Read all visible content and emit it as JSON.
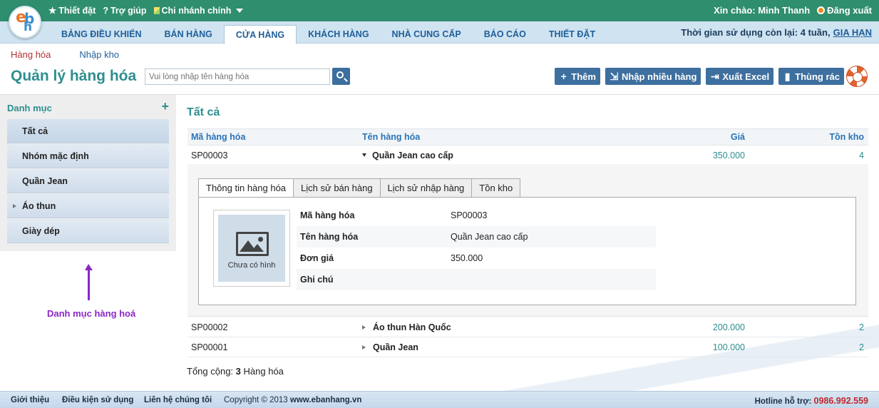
{
  "app": {
    "logo_letters": [
      "e",
      "b",
      "h"
    ],
    "greeting": "Xin chào: Minh Thanh",
    "logout": "Đăng xuất",
    "top_links": [
      {
        "label": "Thiết đặt",
        "icon": "star-icon"
      },
      {
        "label": "Trợ giúp",
        "icon": "help-icon"
      },
      {
        "label": "Chi nhánh chính",
        "icon": "pencil-icon"
      }
    ]
  },
  "nav": {
    "tabs": [
      "BẢNG ĐIỀU KHIỂN",
      "BÁN HÀNG",
      "CỬA HÀNG",
      "KHÁCH HÀNG",
      "NHÀ CUNG CẤP",
      "BÁO CÁO",
      "THIẾT ĐẶT"
    ],
    "active_index": 2,
    "trial_text": "Thời gian sử dụng còn lại: 4 tuần,",
    "trial_link": "GIA HẠN"
  },
  "subnav": {
    "item1": "Hàng hóa",
    "item2": "Nhập kho"
  },
  "page": {
    "title": "Quản lý hàng hóa",
    "search_placeholder": "Vui lòng nhập tên hàng hóa",
    "actions": [
      {
        "label": "Thêm",
        "icon": "plus-icon"
      },
      {
        "label": "Nhập nhiều hàng",
        "icon": "import-icon"
      },
      {
        "label": "Xuất Excel",
        "icon": "export-icon"
      },
      {
        "label": "Thùng rác",
        "icon": "trash-icon"
      }
    ]
  },
  "sidebar": {
    "heading": "Danh mục",
    "add": "+",
    "items": [
      "Tất cả",
      "Nhóm mặc định",
      "Quần Jean",
      "Áo thun",
      "Giày dép"
    ],
    "annotation": "Danh mục hàng hoá"
  },
  "main": {
    "title": "Tất cả",
    "headers": {
      "code": "Mã hàng hóa",
      "name": "Tên hàng hóa",
      "price": "Giá",
      "stock": "Tồn kho"
    },
    "rows": [
      {
        "code": "SP00003",
        "name": "Quần Jean cao cấp",
        "price": "350.000",
        "stock": "4"
      },
      {
        "code": "SP00002",
        "name": "Áo thun Hàn Quốc",
        "price": "200.000",
        "stock": "2"
      },
      {
        "code": "SP00001",
        "name": "Quần Jean",
        "price": "100.000",
        "stock": "2"
      }
    ],
    "detail": {
      "tabs": [
        "Thông tin hàng hóa",
        "Lịch sử bán hàng",
        "Lịch sử nhập hàng",
        "Tồn kho"
      ],
      "image_caption": "Chưa có hình",
      "fields": [
        {
          "label": "Mã hàng hóa",
          "value": "SP00003"
        },
        {
          "label": "Tên hàng hóa",
          "value": "Quần Jean cao cấp"
        },
        {
          "label": "Đơn giá",
          "value": "350.000"
        },
        {
          "label": "Ghi chú",
          "value": ""
        }
      ]
    },
    "total_prefix": "Tổng cộng:",
    "total_count": "3",
    "total_suffix": "Hàng hóa"
  },
  "footer": {
    "links": [
      "Giới thiệu",
      "Điều kiện sử dụng",
      "Liên hệ chúng tôi"
    ],
    "copyright_prefix": "Copyright © 2013",
    "copyright_site": "www.ebanhang.vn",
    "hotline_label": "Hotline hỗ trợ:",
    "hotline_number": "0986.992.559"
  },
  "colors": {
    "brand_green": "#2f8e6e",
    "title_teal": "#2f8e8e",
    "button_blue": "#3d6f9f",
    "annotation_purple": "#8a28c4",
    "hotline_red": "#c0272d"
  }
}
